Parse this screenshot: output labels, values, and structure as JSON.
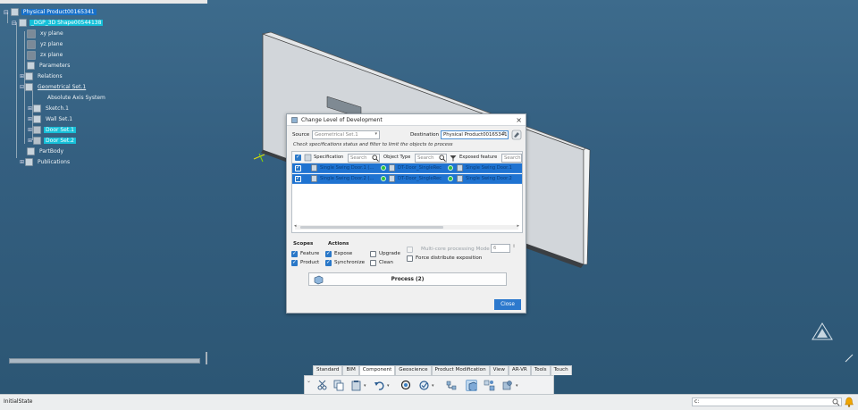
{
  "tree": {
    "root": "Physical Product00165341",
    "part": "_DGP_3D Shape00544138",
    "items": [
      "xy plane",
      "yz plane",
      "zx plane",
      "Parameters",
      "Relations",
      "Geometrical Set.1",
      "Absolute Axis System",
      "Sketch.1",
      "Wall Set.1",
      "Door Set.1",
      "Door Set.2",
      "PartBody",
      "Publications"
    ]
  },
  "dialog": {
    "title": "Change Level of Development",
    "close_symbol": "×",
    "source_label": "Source",
    "source_placeholder": "Geometrical Set.1",
    "destination_label": "Destination",
    "destination_value": "Physical Product00165341",
    "hint": "Check specifications status and filter to limit the objects to process",
    "columns": {
      "specification": "Specification",
      "object_type": "Object Type",
      "exposed_feature": "Exposed feature",
      "search_placeholder": "Search"
    },
    "rows": [
      {
        "specification": "Single Swing Door.1 (...",
        "object_type": "DT-Door_SingleRec",
        "exposed_feature": "Single Swing Door.1"
      },
      {
        "specification": "Single Swing Door.2 (...",
        "object_type": "DT-Door_SingleRec",
        "exposed_feature": "Single Swing Door.2"
      }
    ],
    "scopes_label": "Scopes",
    "actions_label": "Actions",
    "scope_feature": "Feature",
    "scope_product": "Product",
    "action_expose": "Expose",
    "action_synchronize": "Synchronize",
    "action_upgrade": "Upgrade",
    "action_clean": "Clean",
    "multicore_label": "Multi-core processing Mode",
    "multicore_value": "6",
    "force_label": "Force distribute exposition",
    "process_button": "Process (2)",
    "close_button": "Close"
  },
  "tabs": [
    "Standard",
    "BIM",
    "Component",
    "Geoscience",
    "Product Modification",
    "View",
    "AR-VR",
    "Tools",
    "Touch"
  ],
  "active_tab": "Component",
  "status": {
    "text": "InitialState",
    "command_value": "c:"
  },
  "colors": {
    "selection": "#1f73d1",
    "tree_highlight": "#16c0d9",
    "viewport": "#345f80"
  }
}
